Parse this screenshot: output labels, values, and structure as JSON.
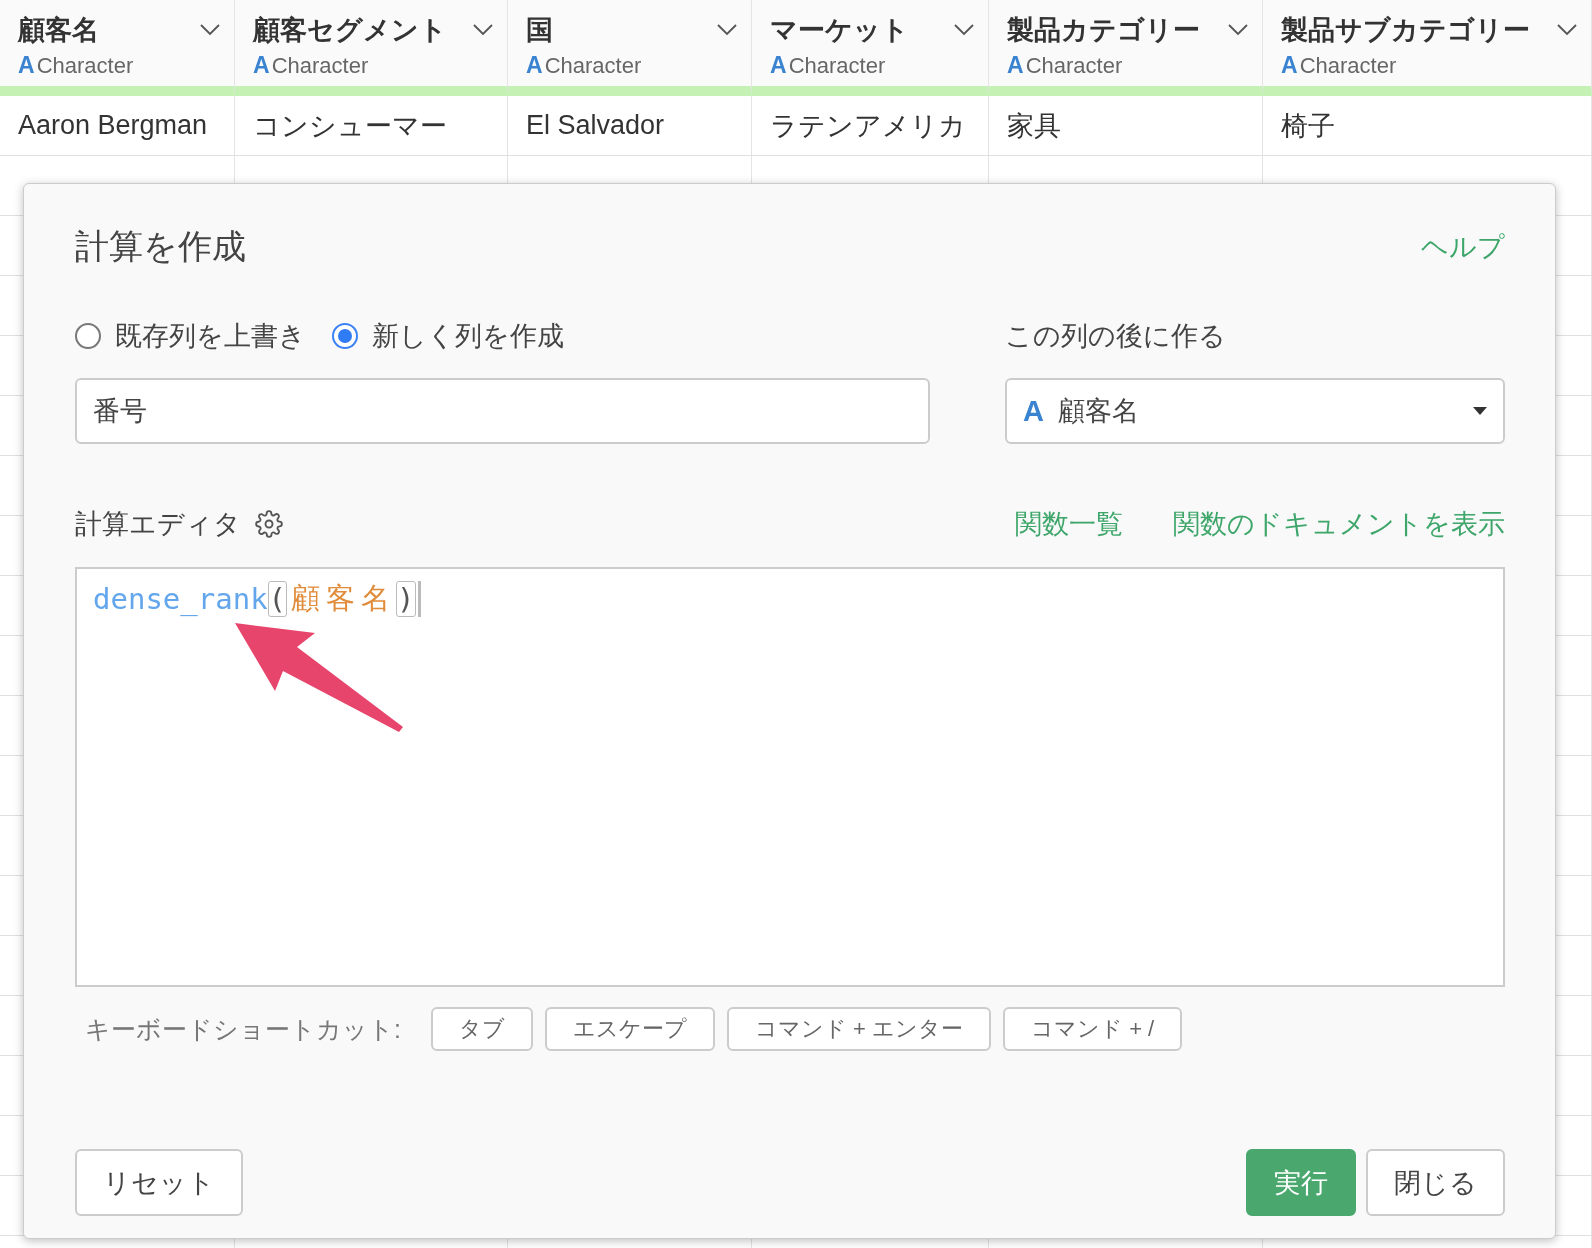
{
  "table": {
    "columns": [
      {
        "name": "顧客名",
        "type_icon": "A",
        "type": "Character"
      },
      {
        "name": "顧客セグメント",
        "type_icon": "A",
        "type": "Character"
      },
      {
        "name": "国",
        "type_icon": "A",
        "type": "Character"
      },
      {
        "name": "マーケット",
        "type_icon": "A",
        "type": "Character"
      },
      {
        "name": "製品カテゴリー",
        "type_icon": "A",
        "type": "Character"
      },
      {
        "name": "製品サブカテゴリー",
        "type_icon": "A",
        "type": "Character"
      }
    ],
    "rows": [
      [
        "Aaron Bergman",
        "コンシューマー",
        "El Salvador",
        "ラテンアメリカ",
        "家具",
        "椅子"
      ]
    ]
  },
  "dialog": {
    "title": "計算を作成",
    "help_link": "ヘルプ",
    "mode_options": [
      {
        "label": "既存列を上書き",
        "selected": false
      },
      {
        "label": "新しく列を作成",
        "selected": true
      }
    ],
    "position_label": "この列の後に作る",
    "name_input": {
      "value": "番号"
    },
    "position_select": {
      "type_icon": "A",
      "value": "顧客名"
    },
    "editor_label": "計算エディタ",
    "editor_links": [
      "関数一覧",
      "関数のドキュメントを表示"
    ],
    "code": {
      "function": "dense_rank",
      "open": "(",
      "argument": "顧客名",
      "close": ")"
    },
    "shortcuts_label": "キーボードショートカット:",
    "shortcuts": [
      "タブ",
      "エスケープ",
      "コマンド + エンター",
      "コマンド + /"
    ],
    "reset_button": "リセット",
    "run_button": "実行",
    "close_button": "閉じる"
  }
}
